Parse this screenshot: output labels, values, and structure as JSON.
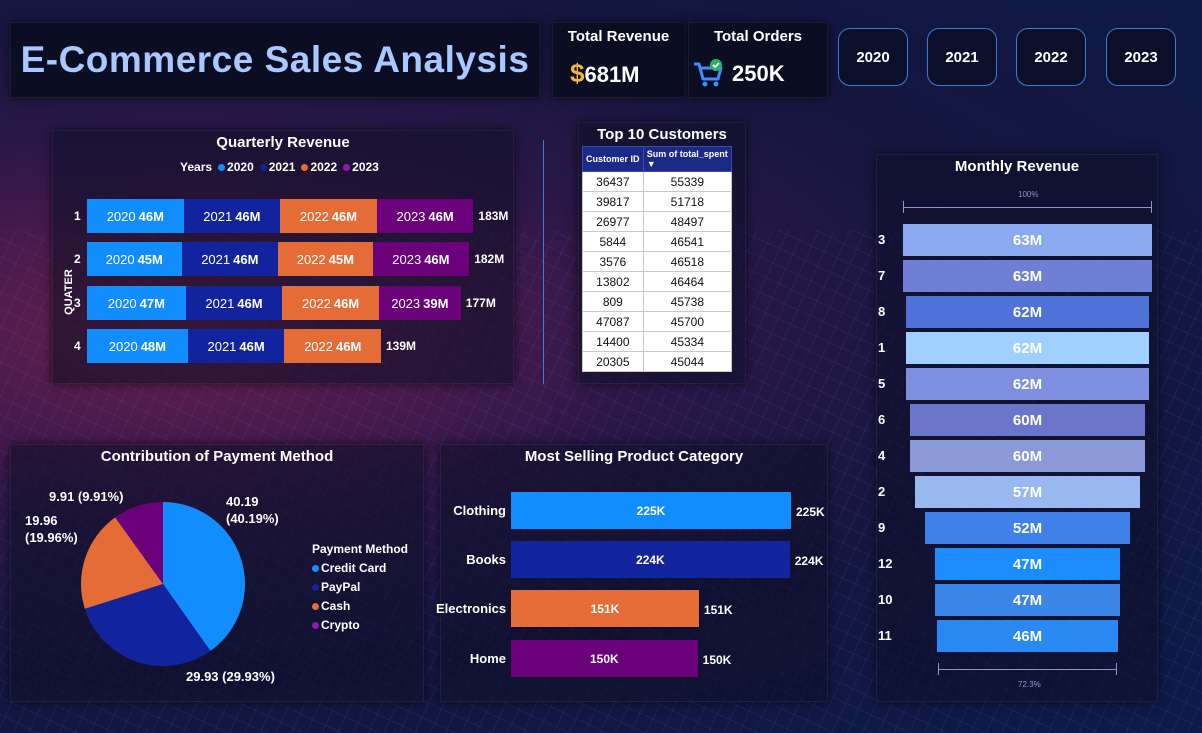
{
  "header": {
    "title": "E-Commerce Sales Analysis",
    "kpis": [
      {
        "label": "Total Revenue",
        "value": "681M",
        "icon": "dollar-icon"
      },
      {
        "label": "Total Orders",
        "value": "250K",
        "icon": "shopping-cart-icon"
      }
    ],
    "years": [
      "2020",
      "2021",
      "2022",
      "2023"
    ]
  },
  "colors": {
    "2020": "#118dff",
    "2021": "#12239e",
    "2022": "#e66c37",
    "2023": "#6b007b"
  },
  "quarterly": {
    "title": "Quarterly Revenue",
    "legend_title": "Years",
    "axis_label": "QUATER",
    "chart_data": {
      "type": "bar",
      "stacked": true,
      "orientation": "horizontal",
      "categories": [
        "1",
        "2",
        "3",
        "4"
      ],
      "series": [
        {
          "name": "2020",
          "values": [
            46,
            45,
            47,
            48
          ],
          "labels": [
            "46M",
            "45M",
            "47M",
            "48M"
          ]
        },
        {
          "name": "2021",
          "values": [
            46,
            46,
            46,
            46
          ],
          "labels": [
            "46M",
            "46M",
            "46M",
            "46M"
          ]
        },
        {
          "name": "2022",
          "values": [
            46,
            45,
            46,
            46
          ],
          "labels": [
            "46M",
            "45M",
            "46M",
            "46M"
          ]
        },
        {
          "name": "2023",
          "values": [
            46,
            46,
            39,
            0
          ],
          "labels": [
            "46M",
            "46M",
            "39M",
            ""
          ]
        }
      ],
      "totals": [
        "183M",
        "182M",
        "177M",
        "139M"
      ]
    }
  },
  "customers": {
    "title": "Top 10 Customers",
    "columns": [
      "Customer ID",
      "Sum of total_spent"
    ],
    "rows": [
      [
        "36437",
        "55339"
      ],
      [
        "39817",
        "51718"
      ],
      [
        "26977",
        "48497"
      ],
      [
        "5844",
        "46541"
      ],
      [
        "3576",
        "46518"
      ],
      [
        "13802",
        "46464"
      ],
      [
        "809",
        "45738"
      ],
      [
        "47087",
        "45700"
      ],
      [
        "14400",
        "45334"
      ],
      [
        "20305",
        "45044"
      ]
    ]
  },
  "monthly": {
    "title": "Monthly Revenue",
    "top_pct": "100%",
    "bottom_pct": "72.3%",
    "chart_data": {
      "type": "bar",
      "subtype": "funnel",
      "categories": [
        "3",
        "7",
        "8",
        "1",
        "5",
        "6",
        "4",
        "2",
        "9",
        "12",
        "10",
        "11"
      ],
      "values": [
        63,
        63,
        62,
        62,
        62,
        60,
        60,
        57,
        52,
        47,
        47,
        46
      ],
      "labels": [
        "63M",
        "63M",
        "62M",
        "62M",
        "62M",
        "60M",
        "60M",
        "57M",
        "52M",
        "47M",
        "47M",
        "46M"
      ],
      "colors": [
        "#8aa9f0",
        "#6f7fd6",
        "#4f72d8",
        "#9fd0ff",
        "#7f8fe0",
        "#6a76c9",
        "#8a9ad8",
        "#9ab8f0",
        "#3f7fe8",
        "#1c8cff",
        "#3b85e6",
        "#2a88f2"
      ]
    }
  },
  "payment": {
    "title": "Contribution of Payment Method",
    "legend_title": "Payment Method",
    "chart_data": {
      "type": "pie",
      "categories": [
        "Credit Card",
        "PayPal",
        "Cash",
        "Crypto"
      ],
      "values": [
        40.19,
        29.93,
        19.96,
        9.91
      ],
      "labels": [
        "40.19\n(40.19%)",
        "29.93 (29.93%)",
        "19.96\n(19.96%)",
        "9.91 (9.91%)"
      ],
      "colors": [
        "#118dff",
        "#12239e",
        "#e66c37",
        "#6b007b"
      ]
    }
  },
  "categories": {
    "title": "Most Selling Product Category",
    "chart_data": {
      "type": "bar",
      "orientation": "horizontal",
      "categories": [
        "Clothing",
        "Books",
        "Electronics",
        "Home"
      ],
      "values": [
        225,
        224,
        151,
        150
      ],
      "labels": [
        "225K",
        "224K",
        "151K",
        "150K"
      ],
      "colors": [
        "#118dff",
        "#12239e",
        "#e66c37",
        "#6b007b"
      ]
    }
  }
}
